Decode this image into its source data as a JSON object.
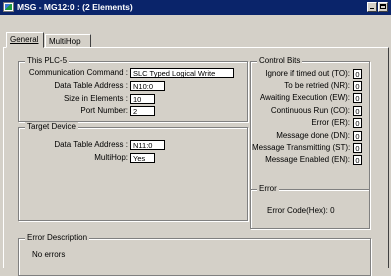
{
  "window": {
    "title": "MSG - MG12:0 : (2 Elements)"
  },
  "tabs": [
    {
      "label": "General"
    },
    {
      "label": "MultiHop"
    }
  ],
  "plc5": {
    "legend": "This PLC-5",
    "fields": [
      {
        "label": "Communication Command :",
        "value": "SLC Typed Logical Write"
      },
      {
        "label": "Data Table Address :",
        "value": "N10:0"
      },
      {
        "label": "Size in Elements :",
        "value": "10"
      },
      {
        "label": "Port Number:",
        "value": "2"
      }
    ]
  },
  "target": {
    "legend": "Target Device",
    "fields": [
      {
        "label": "Data Table Address :",
        "value": "N11:0"
      },
      {
        "label": "MultiHop:",
        "value": "Yes"
      }
    ]
  },
  "control_bits": {
    "legend": "Control Bits",
    "bits": [
      {
        "label": "Ignore if timed out (TO):",
        "value": "0"
      },
      {
        "label": "To be retried (NR):",
        "value": "0"
      },
      {
        "label": "Awaiting Execution (EW):",
        "value": "0"
      },
      {
        "label": "Continuous Run (CO):",
        "value": "0"
      },
      {
        "label": "Error (ER):",
        "value": "0"
      },
      {
        "label": "Message done (DN):",
        "value": "0"
      },
      {
        "label": "Message Transmitting (ST):",
        "value": "0"
      },
      {
        "label": "Message Enabled (EN):",
        "value": "0"
      }
    ]
  },
  "error": {
    "legend": "Error",
    "code_text": "Error Code(Hex):  0"
  },
  "error_description": {
    "legend": "Error Description",
    "text": "No errors"
  }
}
